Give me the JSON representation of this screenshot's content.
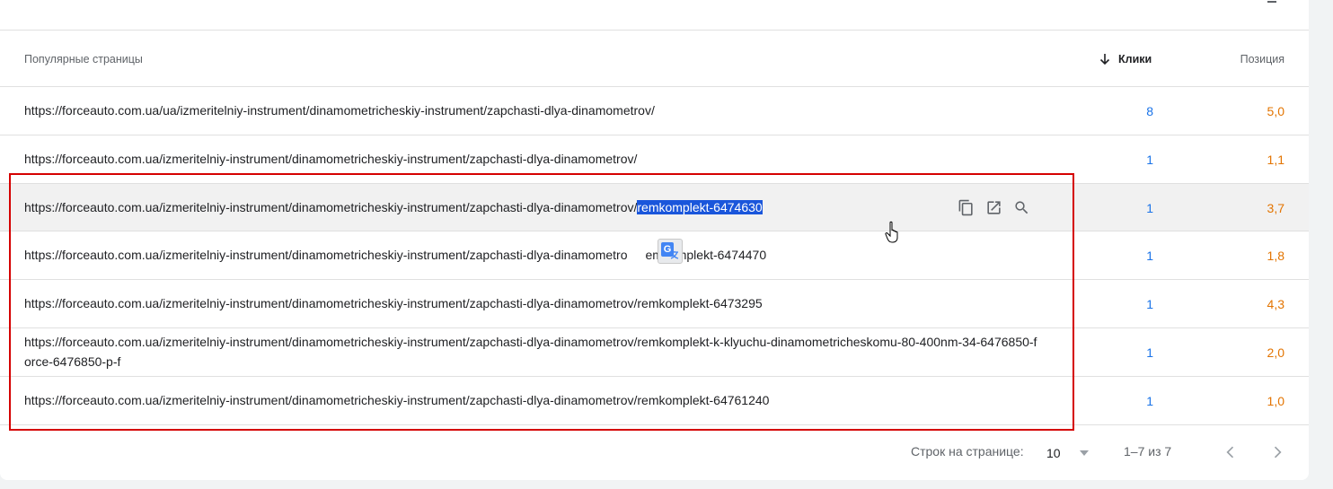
{
  "table": {
    "headers": {
      "pages": "Популярные страницы",
      "clicks": "Клики",
      "position": "Позиция"
    },
    "rows": [
      {
        "url": "https://forceauto.com.ua/ua/izmeritelniy-instrument/dinamometricheskiy-instrument/zapchasti-dlya-dinamometrov/",
        "clicks": "8",
        "position": "5,0"
      },
      {
        "url": "https://forceauto.com.ua/izmeritelniy-instrument/dinamometricheskiy-instrument/zapchasti-dlya-dinamometrov/",
        "clicks": "1",
        "position": "1,1"
      },
      {
        "url_prefix": "https://forceauto.com.ua/izmeritelniy-instrument/dinamometricheskiy-instrument/zapchasti-dlya-dinamometrov/",
        "url_selected": "remkomplekt-6474630",
        "clicks": "1",
        "position": "3,7"
      },
      {
        "url_prefix": "https://forceauto.com.ua/izmeritelniy-instrument/dinamometricheskiy-instrument/zapchasti-dlya-dinamometro",
        "url_suffix": "emkomplekt-6474470",
        "clicks": "1",
        "position": "1,8"
      },
      {
        "url": "https://forceauto.com.ua/izmeritelniy-instrument/dinamometricheskiy-instrument/zapchasti-dlya-dinamometrov/remkomplekt-6473295",
        "clicks": "1",
        "position": "4,3"
      },
      {
        "url": "https://forceauto.com.ua/izmeritelniy-instrument/dinamometricheskiy-instrument/zapchasti-dlya-dinamometrov/remkomplekt-k-klyuchu-dinamometricheskomu-80-400nm-34-6476850-force-6476850-p-f",
        "clicks": "1",
        "position": "2,0"
      },
      {
        "url": "https://forceauto.com.ua/izmeritelniy-instrument/dinamometricheskiy-instrument/zapchasti-dlya-dinamometrov/remkomplekt-64761240",
        "clicks": "1",
        "position": "1,0"
      }
    ]
  },
  "pagination": {
    "rows_per_page_label": "Строк на странице:",
    "rows_per_page_value": "10",
    "range": "1–7 из 7"
  },
  "translate_badge": "G",
  "colors": {
    "clicks": "#1a73e8",
    "position": "#e37400",
    "highlight": "#d50000",
    "selection": "#1a56db"
  },
  "icons": [
    "filter-icon",
    "sort-arrow-down-icon",
    "copy-icon",
    "open-external-icon",
    "search-icon",
    "translate-icon",
    "hand-cursor-icon",
    "chevron-left-icon",
    "chevron-right-icon",
    "dropdown-triangle-icon"
  ]
}
